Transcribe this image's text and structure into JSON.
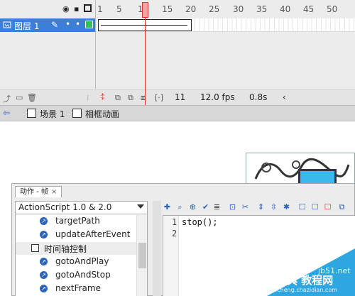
{
  "timeline": {
    "header_icons": [
      "eye-icon",
      "lock-icon",
      "outline-icon"
    ],
    "ruler": [
      "1",
      "5",
      "10",
      "15",
      "20",
      "25",
      "30",
      "35",
      "40",
      "45",
      "50"
    ],
    "layer": {
      "name": "图层 1",
      "icon": "layer-icon",
      "color": "#31c252"
    },
    "footer": {
      "current_frame": "11",
      "fps": "12.0 fps",
      "elapsed": "0.8s"
    }
  },
  "scene_bar": {
    "scene": "场景 1",
    "symbol": "相框动画"
  },
  "actions_panel": {
    "tab_label": "动作 - 帧",
    "version_select": "ActionScript 1.0 & 2.0",
    "tree": [
      {
        "label": "targetPath",
        "kind": "item"
      },
      {
        "label": "updateAfterEvent",
        "kind": "item"
      },
      {
        "label": "时间轴控制",
        "kind": "folder"
      },
      {
        "label": "gotoAndPlay",
        "kind": "item"
      },
      {
        "label": "gotoAndStop",
        "kind": "item"
      },
      {
        "label": "nextFrame",
        "kind": "item"
      }
    ],
    "line_numbers": [
      "1",
      "2"
    ],
    "code": "stop();"
  },
  "watermark": {
    "text": "查字典 教程网",
    "site": "jb51.net",
    "site2": "jiaocheng.chazidian.com"
  },
  "colors": {
    "accent": "#3b7fd6",
    "playhead": "#dd3333",
    "screen": "#39b9ec"
  }
}
